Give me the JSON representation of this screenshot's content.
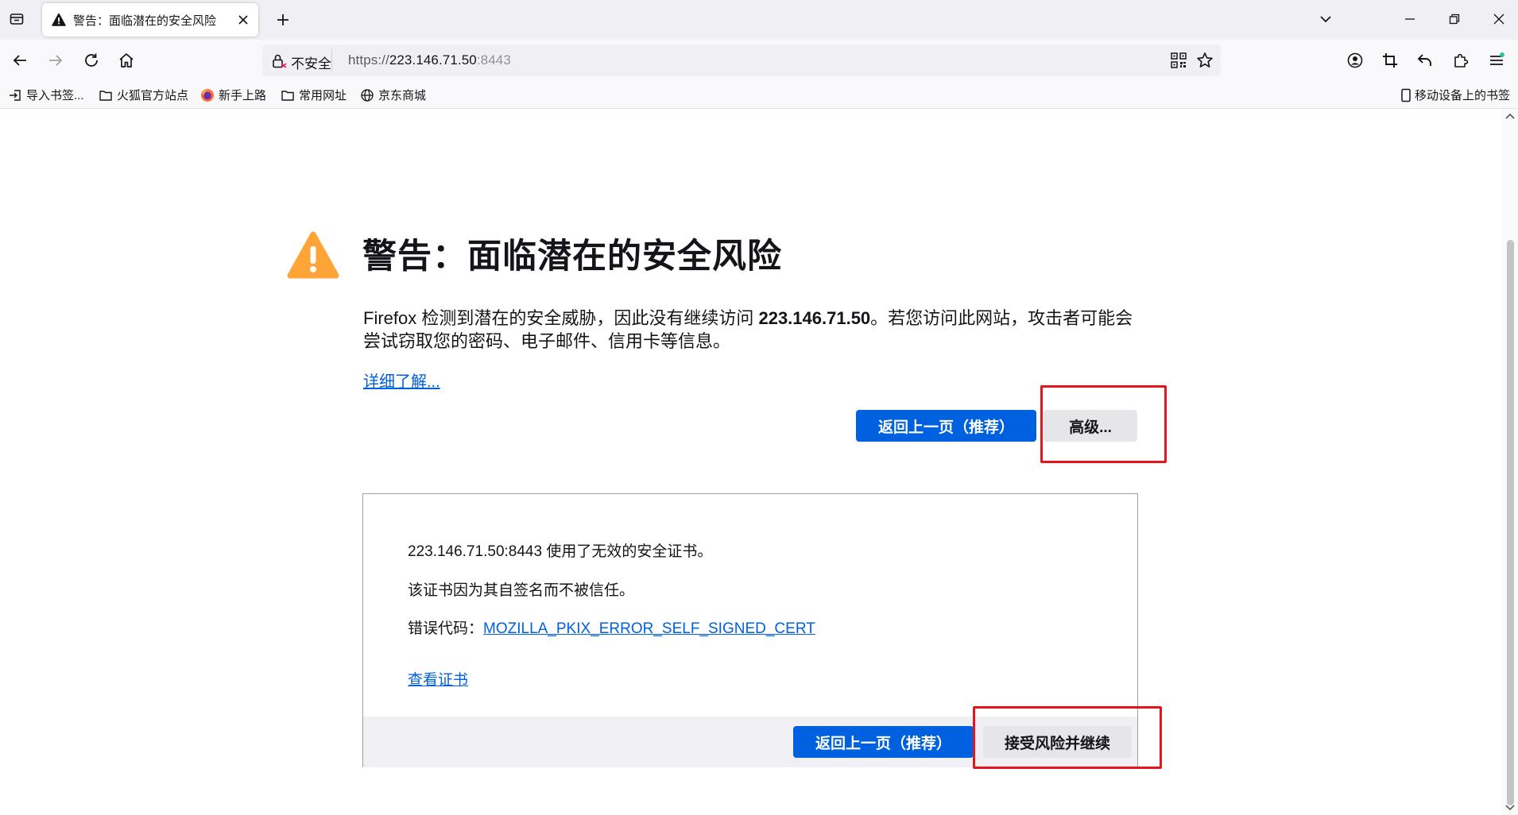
{
  "tab": {
    "title": "警告：面临潜在的安全风险"
  },
  "urlbar": {
    "security_label": "不安全",
    "url_scheme": "https://",
    "url_host": "223.146.71.50",
    "url_port": ":8443"
  },
  "bookmarks": {
    "items": [
      {
        "label": "导入书签...",
        "icon": "import-icon"
      },
      {
        "label": "火狐官方站点",
        "icon": "folder-icon"
      },
      {
        "label": "新手上路",
        "icon": "firefox-icon"
      },
      {
        "label": "常用网址",
        "icon": "folder-icon"
      },
      {
        "label": "京东商城",
        "icon": "globe-icon"
      }
    ],
    "mobile": "移动设备上的书签"
  },
  "warning": {
    "title": "警告：面临潜在的安全风险",
    "desc_before": "Firefox 检测到潜在的安全威胁，因此没有继续访问 ",
    "desc_host": "223.146.71.50",
    "desc_after": "。若您访问此网站，攻击者可能会尝试窃取您的密码、电子邮件、信用卡等信息。",
    "learn_more": "详细了解...",
    "back_button": "返回上一页（推荐）",
    "advanced_button": "高级..."
  },
  "advanced": {
    "line1": "223.146.71.50:8443 使用了无效的安全证书。",
    "line2": "该证书因为其自签名而不被信任。",
    "error_label": "错误代码：",
    "error_code": "MOZILLA_PKIX_ERROR_SELF_SIGNED_CERT",
    "view_cert": "查看证书",
    "back_button": "返回上一页（推荐）",
    "accept_button": "接受风险并继续"
  },
  "colors": {
    "accent": "#0061e0",
    "warning_icon": "#ffa436",
    "annotation": "#e8141c"
  }
}
